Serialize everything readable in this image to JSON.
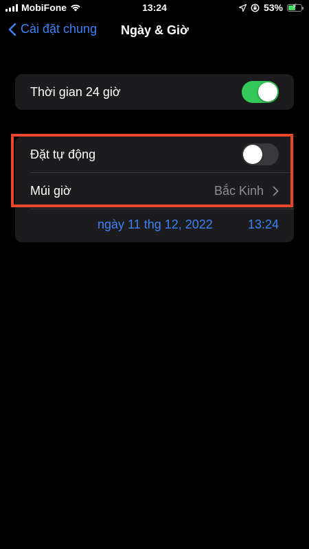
{
  "status_bar": {
    "carrier": "MobiFone",
    "time": "13:24",
    "battery_percent": "53%",
    "battery_level": 0.53,
    "battery_color": "#4cd964"
  },
  "nav": {
    "back_label": "Cài đặt chung",
    "title": "Ngày & Giờ"
  },
  "settings": {
    "hour24": {
      "label": "Thời gian 24 giờ",
      "enabled": true
    },
    "auto_set": {
      "label": "Đặt tự động",
      "enabled": false
    },
    "timezone": {
      "label": "Múi giờ",
      "value": "Bắc Kinh"
    },
    "datetime": {
      "date": "ngày 11 thg 12, 2022",
      "time": "13:24"
    }
  },
  "colors": {
    "accent": "#3b82f6",
    "toggle_on": "#34c759",
    "toggle_off": "#39393d",
    "highlight": "#e8472b"
  },
  "icons": {
    "signal": "cellular-signal-icon",
    "wifi": "wifi-icon",
    "location": "location-arrow-icon",
    "lock": "orientation-lock-icon",
    "battery": "battery-charging-icon",
    "back": "chevron-left-icon",
    "disclosure": "chevron-right-icon"
  }
}
